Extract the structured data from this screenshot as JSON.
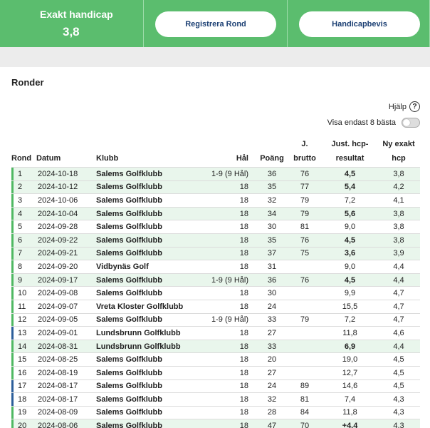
{
  "header": {
    "hcp_title": "Exakt handicap",
    "hcp_value": "3,8",
    "register_button": "Registrera Rond",
    "certificate_button": "Handicapbevis"
  },
  "section": {
    "title": "Ronder",
    "help_label": "Hjälp",
    "help_symbol": "?",
    "toggle_label": "Visa endast 8 bästa"
  },
  "table": {
    "headers": {
      "rond": "Rond",
      "datum": "Datum",
      "klubb": "Klubb",
      "hal": "Hål",
      "poang": "Poäng",
      "brutto_line1": "J.",
      "brutto_line2": "brutto",
      "just_line1": "Just. hcp-",
      "just_line2": "resultat",
      "ny_line1": "Ny exakt",
      "ny_line2": "hcp"
    },
    "rows": [
      {
        "rond": "1",
        "datum": "2024-10-18",
        "klubb": "Salems Golfklubb",
        "hal": "1-9 (9 Hål)",
        "poang": "36",
        "brutto": "76",
        "just": "4,5",
        "ny": "3,8",
        "best": true,
        "bar": "green"
      },
      {
        "rond": "2",
        "datum": "2024-10-12",
        "klubb": "Salems Golfklubb",
        "hal": "18",
        "poang": "35",
        "brutto": "77",
        "just": "5,4",
        "ny": "4,2",
        "best": true,
        "bar": "green"
      },
      {
        "rond": "3",
        "datum": "2024-10-06",
        "klubb": "Salems Golfklubb",
        "hal": "18",
        "poang": "32",
        "brutto": "79",
        "just": "7,2",
        "ny": "4,1",
        "best": false,
        "bar": "green"
      },
      {
        "rond": "4",
        "datum": "2024-10-04",
        "klubb": "Salems Golfklubb",
        "hal": "18",
        "poang": "34",
        "brutto": "79",
        "just": "5,6",
        "ny": "3,8",
        "best": true,
        "bar": "green"
      },
      {
        "rond": "5",
        "datum": "2024-09-28",
        "klubb": "Salems Golfklubb",
        "hal": "18",
        "poang": "30",
        "brutto": "81",
        "just": "9,0",
        "ny": "3,8",
        "best": false,
        "bar": "green"
      },
      {
        "rond": "6",
        "datum": "2024-09-22",
        "klubb": "Salems Golfklubb",
        "hal": "18",
        "poang": "35",
        "brutto": "76",
        "just": "4,5",
        "ny": "3,8",
        "best": true,
        "bar": "green"
      },
      {
        "rond": "7",
        "datum": "2024-09-21",
        "klubb": "Salems Golfklubb",
        "hal": "18",
        "poang": "37",
        "brutto": "75",
        "just": "3,6",
        "ny": "3,9",
        "best": true,
        "bar": "green"
      },
      {
        "rond": "8",
        "datum": "2024-09-20",
        "klubb": "Vidbynäs Golf",
        "hal": "18",
        "poang": "31",
        "brutto": "",
        "just": "9,0",
        "ny": "4,4",
        "best": false,
        "bar": "green"
      },
      {
        "rond": "9",
        "datum": "2024-09-17",
        "klubb": "Salems Golfklubb",
        "hal": "1-9 (9 Hål)",
        "poang": "36",
        "brutto": "76",
        "just": "4,5",
        "ny": "4,4",
        "best": true,
        "bar": "green"
      },
      {
        "rond": "10",
        "datum": "2024-09-08",
        "klubb": "Salems Golfklubb",
        "hal": "18",
        "poang": "30",
        "brutto": "",
        "just": "9,9",
        "ny": "4,7",
        "best": false,
        "bar": "green"
      },
      {
        "rond": "11",
        "datum": "2024-09-07",
        "klubb": "Vreta Kloster Golfklubb",
        "hal": "18",
        "poang": "24",
        "brutto": "",
        "just": "15,5",
        "ny": "4,7",
        "best": false,
        "bar": "green"
      },
      {
        "rond": "12",
        "datum": "2024-09-05",
        "klubb": "Salems Golfklubb",
        "hal": "1-9 (9 Hål)",
        "poang": "33",
        "brutto": "79",
        "just": "7,2",
        "ny": "4,7",
        "best": false,
        "bar": "green"
      },
      {
        "rond": "13",
        "datum": "2024-09-01",
        "klubb": "Lundsbrunn Golfklubb",
        "hal": "18",
        "poang": "27",
        "brutto": "",
        "just": "11,8",
        "ny": "4,6",
        "best": false,
        "bar": "blue"
      },
      {
        "rond": "14",
        "datum": "2024-08-31",
        "klubb": "Lundsbrunn Golfklubb",
        "hal": "18",
        "poang": "33",
        "brutto": "",
        "just": "6,9",
        "ny": "4,4",
        "best": true,
        "bar": "green"
      },
      {
        "rond": "15",
        "datum": "2024-08-25",
        "klubb": "Salems Golfklubb",
        "hal": "18",
        "poang": "20",
        "brutto": "",
        "just": "19,0",
        "ny": "4,5",
        "best": false,
        "bar": "green"
      },
      {
        "rond": "16",
        "datum": "2024-08-19",
        "klubb": "Salems Golfklubb",
        "hal": "18",
        "poang": "27",
        "brutto": "",
        "just": "12,7",
        "ny": "4,5",
        "best": false,
        "bar": "green"
      },
      {
        "rond": "17",
        "datum": "2024-08-17",
        "klubb": "Salems Golfklubb",
        "hal": "18",
        "poang": "24",
        "brutto": "89",
        "just": "14,6",
        "ny": "4,5",
        "best": false,
        "bar": "blue"
      },
      {
        "rond": "18",
        "datum": "2024-08-17",
        "klubb": "Salems Golfklubb",
        "hal": "18",
        "poang": "32",
        "brutto": "81",
        "just": "7,4",
        "ny": "4,3",
        "best": false,
        "bar": "blue"
      },
      {
        "rond": "19",
        "datum": "2024-08-09",
        "klubb": "Salems Golfklubb",
        "hal": "18",
        "poang": "28",
        "brutto": "84",
        "just": "11,8",
        "ny": "4,3",
        "best": false,
        "bar": "green"
      },
      {
        "rond": "20",
        "datum": "2024-08-06",
        "klubb": "Salems Golfklubb",
        "hal": "18",
        "poang": "47",
        "brutto": "70",
        "just": "+4,4",
        "ny": "4,3",
        "best": true,
        "bar": "green"
      }
    ]
  },
  "colors": {
    "header_green": "#5bbd6e",
    "row_alt": "#e9f6ec",
    "bar_green": "#4fb862",
    "bar_blue": "#2c5e9a",
    "button_text": "#1b3f73"
  }
}
